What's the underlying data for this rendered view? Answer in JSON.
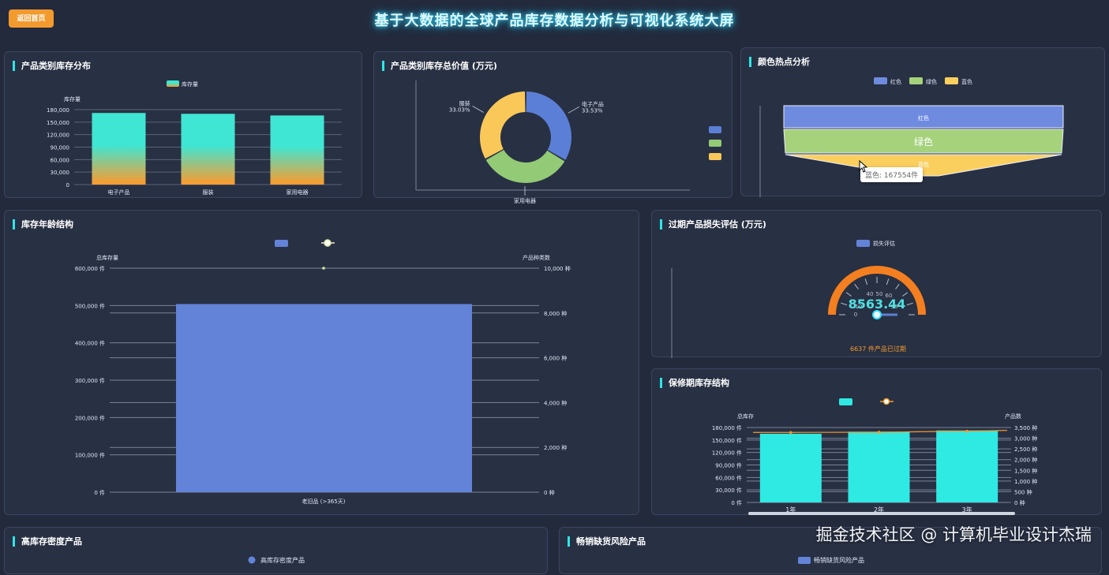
{
  "header": {
    "back_label": "返回首页",
    "title": "基于大数据的全球产品库存数据分析与可视化系统大屏"
  },
  "panels": {
    "category_inventory": {
      "title": "产品类别库存分布",
      "chart_data": {
        "type": "bar",
        "legend": [
          "库存量"
        ],
        "ylabel": "库存量",
        "categories": [
          "电子产品",
          "服装",
          "家用电器"
        ],
        "values": [
          172000,
          170000,
          166000
        ],
        "ylim": [
          0,
          180000
        ],
        "yticks": [
          "0",
          "30,000",
          "60,000",
          "90,000",
          "120,000",
          "150,000",
          "180,000"
        ],
        "colors": {
          "top": "#3fe6d3",
          "bottom": "#ff9a2b"
        }
      }
    },
    "category_value": {
      "title": "产品类别库存总价值 (万元)",
      "chart_data": {
        "type": "pie",
        "slices": [
          {
            "label": "电子产品",
            "percent_label": "33.53%",
            "value": 33.53,
            "color": "#5b7fd6"
          },
          {
            "label": "家用电器",
            "percent_label": "",
            "value": 33.44,
            "color": "#93ca76"
          },
          {
            "label": "服装",
            "percent_label": "33.03%",
            "value": 33.03,
            "color": "#fac858"
          }
        ]
      }
    },
    "color_hotspot": {
      "title": "颜色热点分析",
      "chart_data": {
        "type": "funnel",
        "legend": [
          {
            "label": "红色",
            "color": "#6f8be0"
          },
          {
            "label": "绿色",
            "color": "#a5d27b"
          },
          {
            "label": "蓝色",
            "color": "#fbcf5e"
          }
        ],
        "layers": [
          {
            "label": "红色",
            "color": "#6f8be0"
          },
          {
            "label": "绿色",
            "color": "#a5d27b"
          },
          {
            "label": "蓝色",
            "color": "#fbcf5e",
            "value": 167554
          }
        ],
        "tooltip": "蓝色: 167554件"
      }
    },
    "age_structure": {
      "title": "库存年龄结构",
      "chart_data": {
        "type": "bar",
        "left_axis_label": "总库存量",
        "right_axis_label": "产品种类数",
        "categories": [
          "老旧品 (>365天)"
        ],
        "values": [
          504000
        ],
        "ylim": [
          0,
          600000
        ],
        "yticks": [
          "0 件",
          "100,000 件",
          "200,000 件",
          "300,000 件",
          "400,000 件",
          "500,000 件",
          "600,000 件"
        ],
        "y2lim": [
          0,
          10000
        ],
        "y2ticks": [
          "0 种",
          "2,000 种",
          "4,000 种",
          "6,000 种",
          "8,000 种",
          "10,000 种"
        ],
        "line_values": [
          10000
        ],
        "bar_color": "#6383d9"
      }
    },
    "expired_loss": {
      "title": "过期产品损失评估 (万元)",
      "chart_data": {
        "type": "gauge",
        "legend": [
          "损失评估"
        ],
        "value_label": "8563.44",
        "value": 8563.44,
        "scale_labels": [
          "0",
          "10",
          "40",
          "50",
          "60",
          "90"
        ],
        "color": "#f47f20"
      },
      "note": "6637 件产品已过期"
    },
    "warranty_structure": {
      "title": "保修期库存结构",
      "chart_data": {
        "type": "bar",
        "left_axis_label": "总库存",
        "right_axis_label": "产品数",
        "categories": [
          "1年",
          "2年",
          "3年"
        ],
        "values": [
          165000,
          170000,
          173000
        ],
        "ylim": [
          0,
          180000
        ],
        "yticks": [
          "0 件",
          "30,000 件",
          "60,000 件",
          "90,000 件",
          "120,000 件",
          "150,000 件",
          "180,000 件"
        ],
        "y2lim": [
          0,
          3500
        ],
        "y2ticks": [
          "0 种",
          "500 种",
          "1,000 种",
          "1,500 种",
          "2,000 种",
          "2,500 种",
          "3,000 种",
          "3,500 种"
        ],
        "line_values": [
          3270,
          3280,
          3330
        ],
        "bar_color": "#2fe9e3",
        "line_color": "#f39a2e"
      }
    },
    "high_density": {
      "title": "高库存密度产品",
      "legend": [
        "高库存密度产品"
      ]
    },
    "stockout_risk": {
      "title": "畅销缺货风险产品",
      "legend": [
        "畅销缺货风险产品"
      ]
    }
  },
  "watermark": "掘金技术社区 @ 计算机毕业设计杰瑞"
}
